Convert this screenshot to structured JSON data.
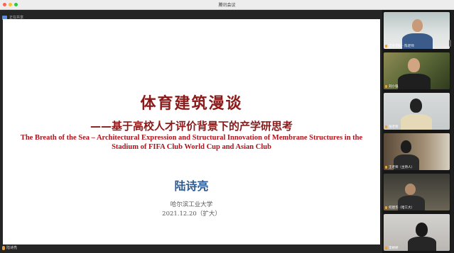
{
  "window": {
    "title": "腾讯会议"
  },
  "share": {
    "sharer_label": "正在共享"
  },
  "slide": {
    "title": "体育建筑漫谈",
    "subtitle": "——基于高校人才评价背景下的产学研思考",
    "english_title": "The Breath of the Sea – Architectural Expression and Structural Innovation of Membrane Structures in the Stadium of FIFA Club World Cup and Asian Club",
    "author": "陆诗亮",
    "organization": "哈尔滨工业大学",
    "date": "2021.12.20（扩大）"
  },
  "presenter": {
    "name": "陆诗亮"
  },
  "participants": [
    {
      "name": "艺术学院 · 陈老师"
    },
    {
      "name": "刘小强"
    },
    {
      "name": "张老师"
    },
    {
      "name": "王老师（主持人）"
    },
    {
      "name": "何建华（哈工大）"
    },
    {
      "name": "李婷婷"
    }
  ],
  "colors": {
    "title_red": "#8b1a1a",
    "english_red": "#b0121b",
    "author_blue": "#2e5b93"
  }
}
